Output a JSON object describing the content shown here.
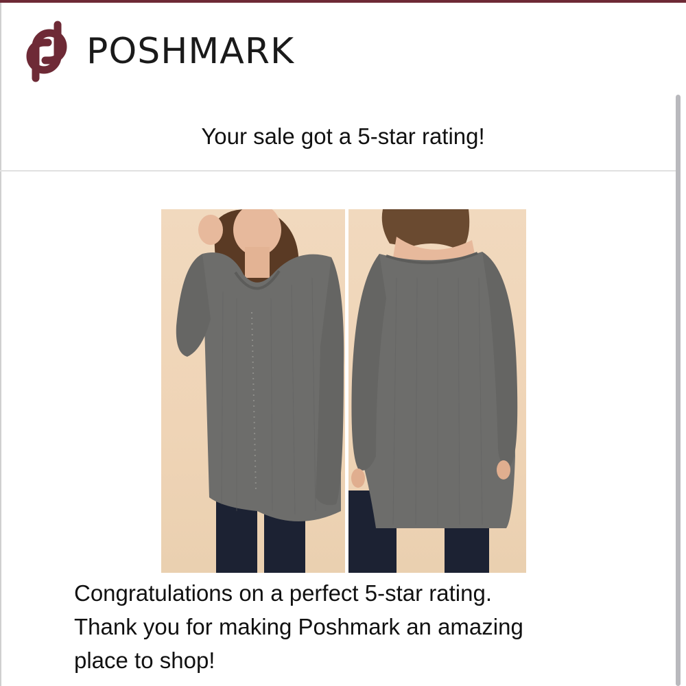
{
  "brand": {
    "name": "POSHMARK",
    "logo_icon": "poshmark-logo-icon",
    "brand_color": "#6e2a36"
  },
  "email": {
    "subject": "Your sale got a 5-star rating!",
    "message_lines": [
      "Congratulations on a perfect 5-star rating.",
      "Thank you for making Poshmark an amazing",
      "place to shop!"
    ]
  },
  "product": {
    "images": [
      {
        "view": "front",
        "description_icon": "sweater-front-photo"
      },
      {
        "view": "back",
        "description_icon": "sweater-back-photo"
      }
    ],
    "sweater_color": "#6d6d6b",
    "jeans_color": "#1c2233",
    "background_color": "#efd4b6"
  }
}
